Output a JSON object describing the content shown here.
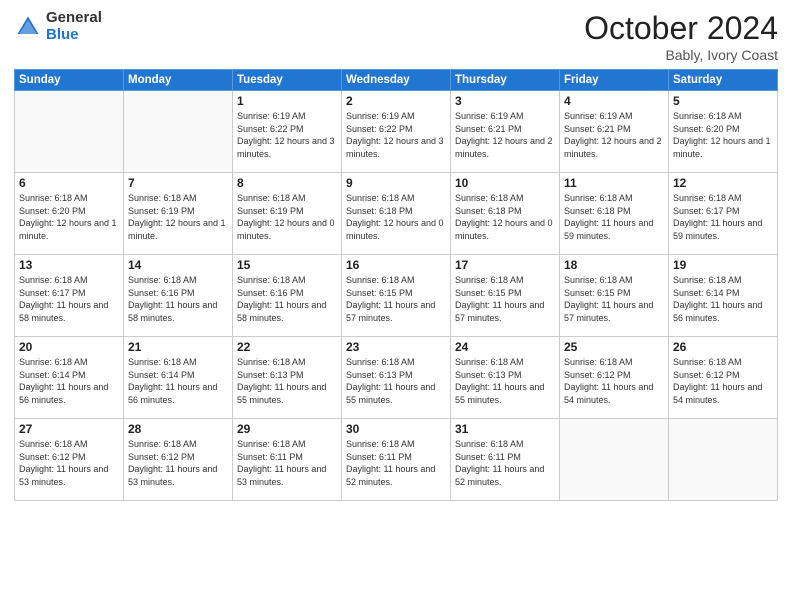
{
  "logo": {
    "general": "General",
    "blue": "Blue"
  },
  "header": {
    "month": "October 2024",
    "location": "Bably, Ivory Coast"
  },
  "days_of_week": [
    "Sunday",
    "Monday",
    "Tuesday",
    "Wednesday",
    "Thursday",
    "Friday",
    "Saturday"
  ],
  "weeks": [
    [
      {
        "day": "",
        "info": ""
      },
      {
        "day": "",
        "info": ""
      },
      {
        "day": "1",
        "info": "Sunrise: 6:19 AM\nSunset: 6:22 PM\nDaylight: 12 hours and 3 minutes."
      },
      {
        "day": "2",
        "info": "Sunrise: 6:19 AM\nSunset: 6:22 PM\nDaylight: 12 hours and 3 minutes."
      },
      {
        "day": "3",
        "info": "Sunrise: 6:19 AM\nSunset: 6:21 PM\nDaylight: 12 hours and 2 minutes."
      },
      {
        "day": "4",
        "info": "Sunrise: 6:19 AM\nSunset: 6:21 PM\nDaylight: 12 hours and 2 minutes."
      },
      {
        "day": "5",
        "info": "Sunrise: 6:18 AM\nSunset: 6:20 PM\nDaylight: 12 hours and 1 minute."
      }
    ],
    [
      {
        "day": "6",
        "info": "Sunrise: 6:18 AM\nSunset: 6:20 PM\nDaylight: 12 hours and 1 minute."
      },
      {
        "day": "7",
        "info": "Sunrise: 6:18 AM\nSunset: 6:19 PM\nDaylight: 12 hours and 1 minute."
      },
      {
        "day": "8",
        "info": "Sunrise: 6:18 AM\nSunset: 6:19 PM\nDaylight: 12 hours and 0 minutes."
      },
      {
        "day": "9",
        "info": "Sunrise: 6:18 AM\nSunset: 6:18 PM\nDaylight: 12 hours and 0 minutes."
      },
      {
        "day": "10",
        "info": "Sunrise: 6:18 AM\nSunset: 6:18 PM\nDaylight: 12 hours and 0 minutes."
      },
      {
        "day": "11",
        "info": "Sunrise: 6:18 AM\nSunset: 6:18 PM\nDaylight: 11 hours and 59 minutes."
      },
      {
        "day": "12",
        "info": "Sunrise: 6:18 AM\nSunset: 6:17 PM\nDaylight: 11 hours and 59 minutes."
      }
    ],
    [
      {
        "day": "13",
        "info": "Sunrise: 6:18 AM\nSunset: 6:17 PM\nDaylight: 11 hours and 58 minutes."
      },
      {
        "day": "14",
        "info": "Sunrise: 6:18 AM\nSunset: 6:16 PM\nDaylight: 11 hours and 58 minutes."
      },
      {
        "day": "15",
        "info": "Sunrise: 6:18 AM\nSunset: 6:16 PM\nDaylight: 11 hours and 58 minutes."
      },
      {
        "day": "16",
        "info": "Sunrise: 6:18 AM\nSunset: 6:15 PM\nDaylight: 11 hours and 57 minutes."
      },
      {
        "day": "17",
        "info": "Sunrise: 6:18 AM\nSunset: 6:15 PM\nDaylight: 11 hours and 57 minutes."
      },
      {
        "day": "18",
        "info": "Sunrise: 6:18 AM\nSunset: 6:15 PM\nDaylight: 11 hours and 57 minutes."
      },
      {
        "day": "19",
        "info": "Sunrise: 6:18 AM\nSunset: 6:14 PM\nDaylight: 11 hours and 56 minutes."
      }
    ],
    [
      {
        "day": "20",
        "info": "Sunrise: 6:18 AM\nSunset: 6:14 PM\nDaylight: 11 hours and 56 minutes."
      },
      {
        "day": "21",
        "info": "Sunrise: 6:18 AM\nSunset: 6:14 PM\nDaylight: 11 hours and 56 minutes."
      },
      {
        "day": "22",
        "info": "Sunrise: 6:18 AM\nSunset: 6:13 PM\nDaylight: 11 hours and 55 minutes."
      },
      {
        "day": "23",
        "info": "Sunrise: 6:18 AM\nSunset: 6:13 PM\nDaylight: 11 hours and 55 minutes."
      },
      {
        "day": "24",
        "info": "Sunrise: 6:18 AM\nSunset: 6:13 PM\nDaylight: 11 hours and 55 minutes."
      },
      {
        "day": "25",
        "info": "Sunrise: 6:18 AM\nSunset: 6:12 PM\nDaylight: 11 hours and 54 minutes."
      },
      {
        "day": "26",
        "info": "Sunrise: 6:18 AM\nSunset: 6:12 PM\nDaylight: 11 hours and 54 minutes."
      }
    ],
    [
      {
        "day": "27",
        "info": "Sunrise: 6:18 AM\nSunset: 6:12 PM\nDaylight: 11 hours and 53 minutes."
      },
      {
        "day": "28",
        "info": "Sunrise: 6:18 AM\nSunset: 6:12 PM\nDaylight: 11 hours and 53 minutes."
      },
      {
        "day": "29",
        "info": "Sunrise: 6:18 AM\nSunset: 6:11 PM\nDaylight: 11 hours and 53 minutes."
      },
      {
        "day": "30",
        "info": "Sunrise: 6:18 AM\nSunset: 6:11 PM\nDaylight: 11 hours and 52 minutes."
      },
      {
        "day": "31",
        "info": "Sunrise: 6:18 AM\nSunset: 6:11 PM\nDaylight: 11 hours and 52 minutes."
      },
      {
        "day": "",
        "info": ""
      },
      {
        "day": "",
        "info": ""
      }
    ]
  ]
}
